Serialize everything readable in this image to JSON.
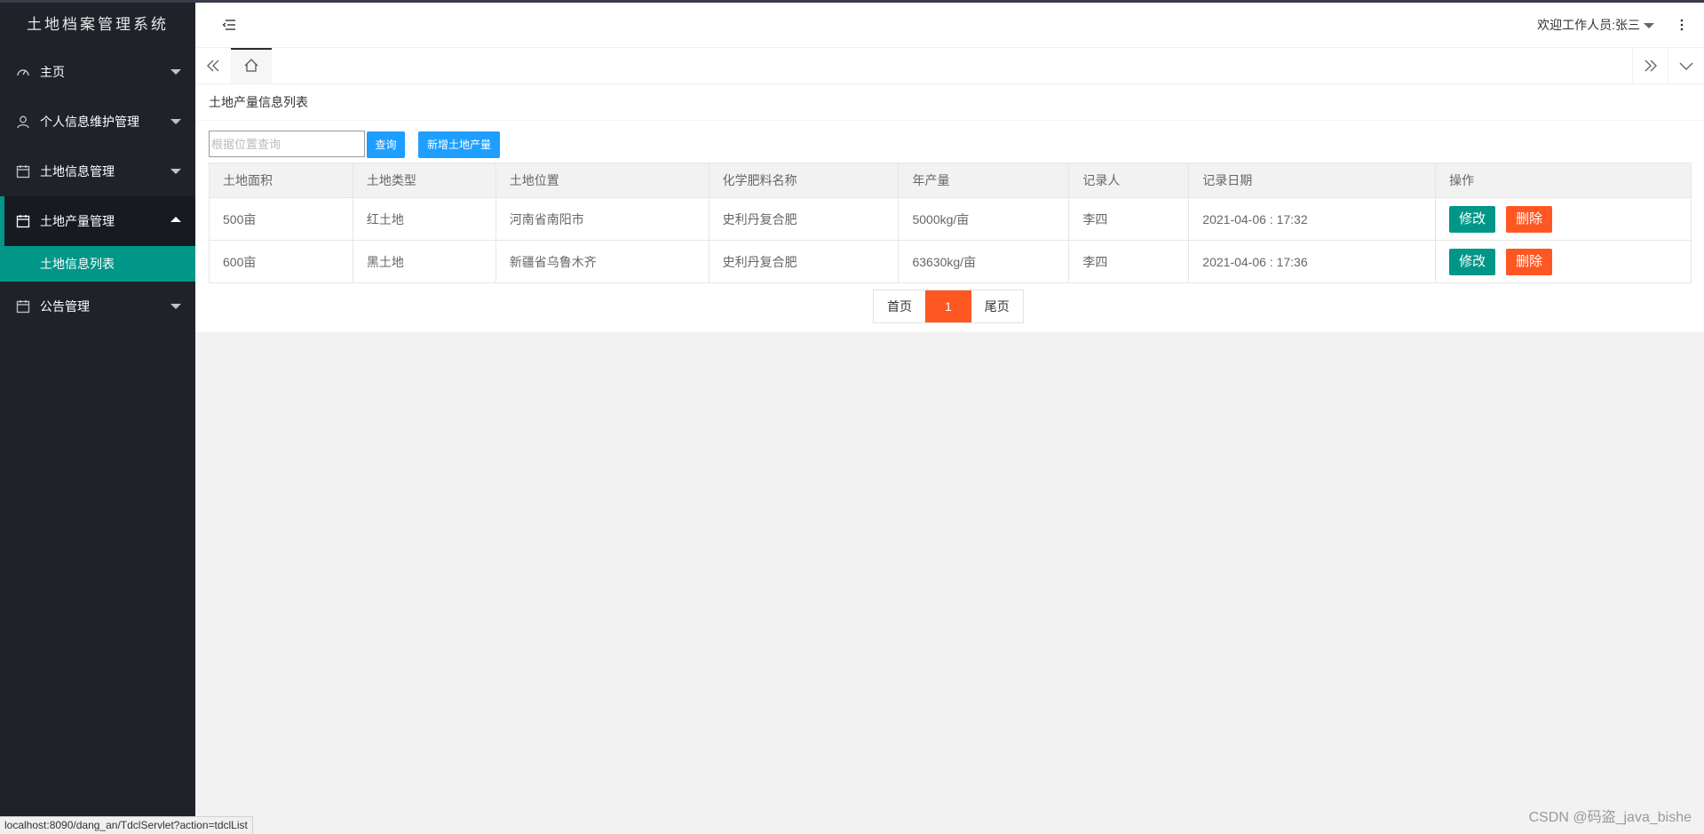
{
  "app": {
    "title": "土地档案管理系统"
  },
  "sidebar": {
    "items": [
      {
        "label": "主页",
        "icon": "dashboard-icon"
      },
      {
        "label": "个人信息维护管理",
        "icon": "user-icon"
      },
      {
        "label": "土地信息管理",
        "icon": "calendar-icon"
      },
      {
        "label": "土地产量管理",
        "icon": "calendar-icon",
        "expanded": true,
        "children": [
          {
            "label": "土地信息列表",
            "active": true
          }
        ]
      },
      {
        "label": "公告管理",
        "icon": "calendar-icon"
      }
    ]
  },
  "header": {
    "welcome": "欢迎工作人员:张三"
  },
  "page": {
    "title": "土地产量信息列表",
    "search": {
      "placeholder": "根据位置查询",
      "value": ""
    },
    "query_label": "查询",
    "add_label": "新增土地产量",
    "columns": [
      "土地面积",
      "土地类型",
      "土地位置",
      "化学肥料名称",
      "年产量",
      "记录人",
      "记录日期",
      "操作"
    ],
    "rows": [
      [
        "500亩",
        "红土地",
        "河南省南阳市",
        "史利丹复合肥",
        "5000kg/亩",
        "李四",
        "2021-04-06 : 17:32"
      ],
      [
        "600亩",
        "黑土地",
        "新疆省乌鲁木齐",
        "史利丹复合肥",
        "63630kg/亩",
        "李四",
        "2021-04-06 : 17:36"
      ]
    ],
    "edit_label": "修改",
    "delete_label": "删除",
    "pager": {
      "first": "首页",
      "current": "1",
      "last": "尾页"
    }
  },
  "status_url": "localhost:8090/dang_an/TdclServlet?action=tdclList",
  "watermark": "CSDN @码盗_java_bishe",
  "colors": {
    "sidebar": "#20222a",
    "accent": "#009688",
    "danger": "#ff5722",
    "primary": "#1e9fff"
  }
}
